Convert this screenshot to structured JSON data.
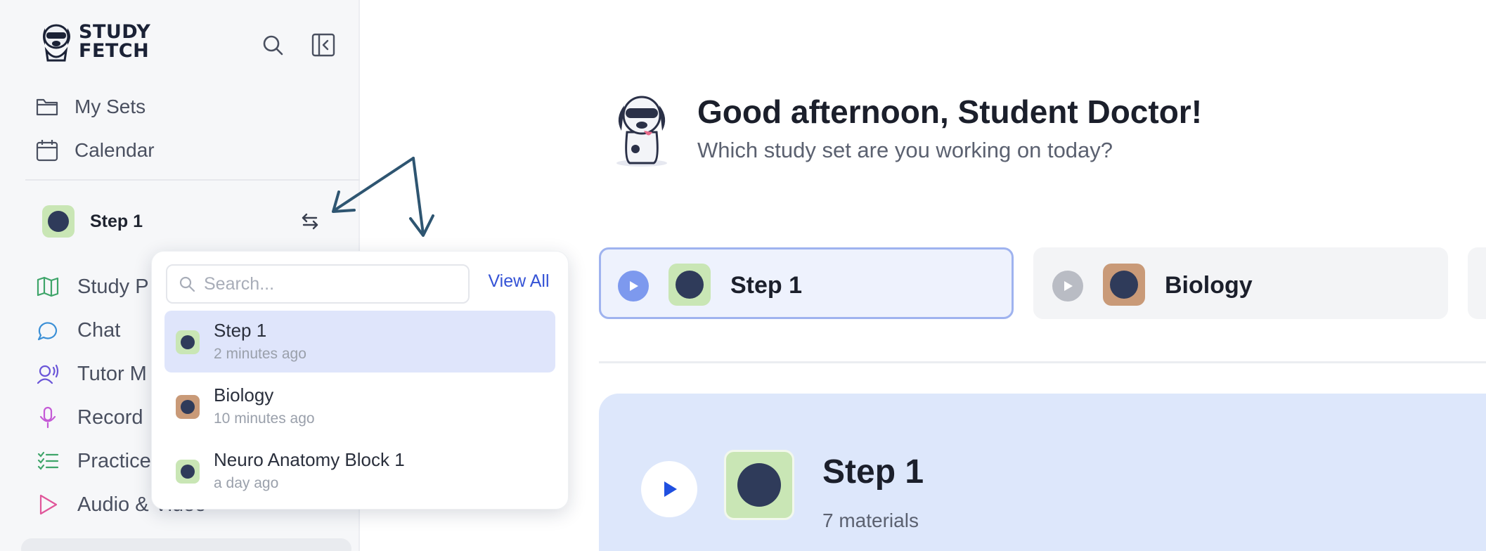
{
  "sidebar": {
    "logo": {
      "line1": "STUDY",
      "line2": "FETCH"
    },
    "nav": [
      {
        "label": "My Sets",
        "icon": "folder-icon"
      },
      {
        "label": "Calendar",
        "icon": "calendar-icon"
      }
    ],
    "current_set": {
      "label": "Step 1"
    },
    "tools": [
      {
        "label": "Study P",
        "icon": "map-icon"
      },
      {
        "label": "Chat",
        "icon": "chat-icon"
      },
      {
        "label": "Tutor M",
        "icon": "tutor-icon"
      },
      {
        "label": "Record",
        "icon": "mic-icon"
      },
      {
        "label": "Practice",
        "icon": "list-check-icon"
      },
      {
        "label": "Audio & Video",
        "icon": "play-outline-icon"
      }
    ]
  },
  "dropdown": {
    "search_placeholder": "Search...",
    "view_all": "View All",
    "items": [
      {
        "name": "Step 1",
        "time": "2 minutes ago",
        "thumb_color": "#c9e6b5",
        "active": true
      },
      {
        "name": "Biology",
        "time": "10 minutes ago",
        "thumb_color": "#c99a78",
        "active": false
      },
      {
        "name": "Neuro Anatomy Block 1",
        "time": "a day ago",
        "thumb_color": "#c9e6b5",
        "active": false
      }
    ]
  },
  "main": {
    "greeting": "Good afternoon, Student Doctor!",
    "subgreeting": "Which study set are you working on today?",
    "tabs": [
      {
        "label": "Step 1",
        "thumb_color": "#c9e6b5",
        "selected": true
      },
      {
        "label": "Biology",
        "thumb_color": "#c99a78",
        "selected": false
      }
    ],
    "hero": {
      "title": "Step 1",
      "subtitle": "7 materials"
    }
  },
  "colors": {
    "accent": "#3553d6",
    "selected_bg": "#dfe5fb",
    "hero_bg": "#dde7fb",
    "arrow": "#2e5571"
  }
}
